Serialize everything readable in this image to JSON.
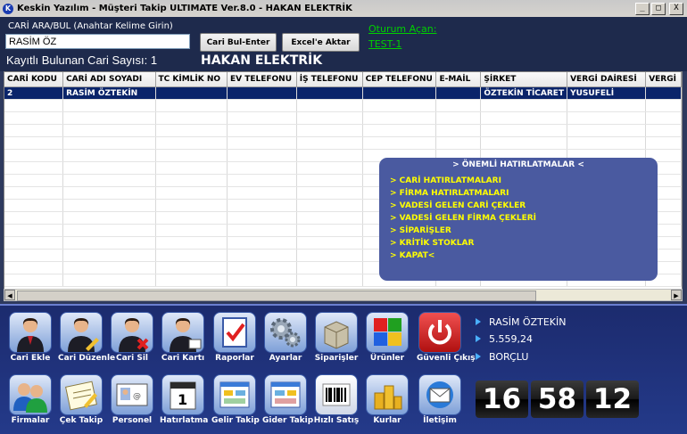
{
  "window": {
    "title": "Keskin Yazılım - Müşteri Takip ULTIMATE Ver.8.0 - HAKAN ELEKTRİK",
    "minimize_glyph": "_",
    "maximize_glyph": "□",
    "close_glyph": "X"
  },
  "search": {
    "label": "CARİ ARA/BUL (Anahtar Kelime Girin)",
    "value": "RASİM ÖZ",
    "find_button": "Cari Bul-Enter",
    "excel_button": "Excel'e Aktar"
  },
  "session": {
    "label": "Oturum Açan:",
    "user": "TEST-1"
  },
  "summary": {
    "count_label": "Kayıtlı Bulunan Cari Sayısı: 1",
    "company": "HAKAN ELEKTRİK"
  },
  "grid": {
    "columns": [
      "CARİ KODU",
      "CARİ ADI SOYADI",
      "TC KİMLİK NO",
      "EV TELEFONU",
      "İŞ TELEFONU",
      "CEP TELEFONU",
      "E-MAİL",
      "ŞİRKET",
      "VERGİ DAİRESİ",
      "VERGİ"
    ],
    "rows": [
      [
        "2",
        "RASİM ÖZTEKİN",
        "",
        "",
        "",
        "",
        "",
        "ÖZTEKİN TİCARET",
        "YUSUFELİ",
        ""
      ]
    ]
  },
  "reminders": {
    "title": "> ÖNEMLİ HATIRLATMALAR <",
    "items": [
      "> CARİ HATIRLATMALARI",
      "> FİRMA HATIRLATMALARI",
      "> VADESİ GELEN CARİ ÇEKLER",
      "> VADESİ GELEN FİRMA ÇEKLERİ",
      "> SİPARİŞLER",
      "> KRİTİK STOKLAR",
      "> KAPAT<"
    ]
  },
  "toolbar_row1": [
    {
      "label": "Cari Ekle",
      "icon": "user-add-icon"
    },
    {
      "label": "Cari Düzenle",
      "icon": "user-edit-icon"
    },
    {
      "label": "Cari Sil",
      "icon": "user-delete-icon"
    },
    {
      "label": "Cari Kartı",
      "icon": "user-card-icon"
    },
    {
      "label": "Raporlar",
      "icon": "report-check-icon"
    },
    {
      "label": "Ayarlar",
      "icon": "gears-icon"
    },
    {
      "label": "Siparişler",
      "icon": "box-order-icon"
    },
    {
      "label": "Ürünler",
      "icon": "products-tiles-icon"
    },
    {
      "label": "Güvenli Çıkış",
      "icon": "power-icon"
    }
  ],
  "toolbar_row2": [
    {
      "label": "Firmalar",
      "icon": "users-group-icon"
    },
    {
      "label": "Çek Takip",
      "icon": "check-notes-icon"
    },
    {
      "label": "Personel",
      "icon": "personnel-card-icon"
    },
    {
      "label": "Hatırlatma",
      "icon": "calendar-icon"
    },
    {
      "label": "Gelir Takip",
      "icon": "income-window-icon"
    },
    {
      "label": "Gider Takip",
      "icon": "expense-window-icon"
    },
    {
      "label": "Hızlı Satış",
      "icon": "barcode-icon"
    },
    {
      "label": "Kurlar",
      "icon": "coins-icon"
    },
    {
      "label": "İletişim",
      "icon": "mail-icon"
    }
  ],
  "customer_info": {
    "name": "RASİM ÖZTEKİN",
    "balance": "5.559,24",
    "status": "BORÇLU"
  },
  "clock": {
    "hours": "16",
    "minutes": "58",
    "seconds": "12"
  },
  "colors": {
    "accent": "#0a246a",
    "session_green": "#00d000",
    "reminder_yellow": "#ffff00",
    "panel_blue": "#4a5aa0"
  }
}
